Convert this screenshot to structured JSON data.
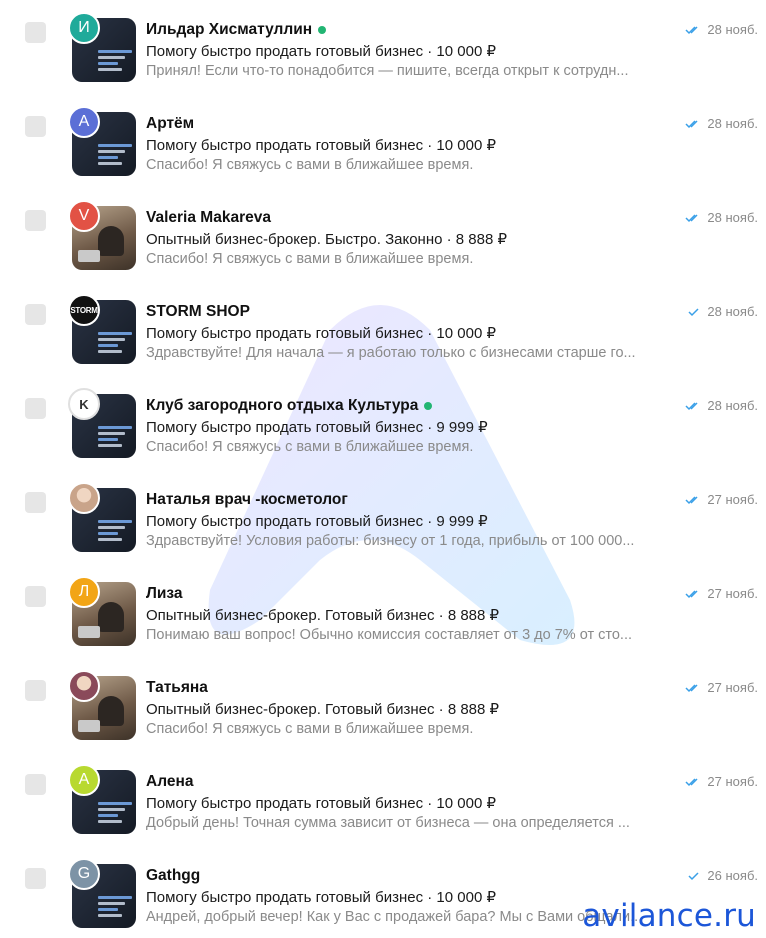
{
  "chats": [
    {
      "name": "Ильдар Хисматуллин",
      "avatar_letter": "И",
      "avatar_color": "#1faa9a",
      "avatar_type": "letter",
      "thumb": "dark",
      "online": true,
      "subject": "Помогу быстро продать готовый бизнес · 10 000 ₽",
      "preview": "Принял! Если что-то понадобится — пишите, всегда открыт к сотрудн...",
      "date": "28 нояб.",
      "ticks": "double"
    },
    {
      "name": "Артём",
      "avatar_letter": "А",
      "avatar_color": "#5b6fd6",
      "avatar_type": "letter",
      "thumb": "dark",
      "online": false,
      "subject": "Помогу быстро продать готовый бизнес · 10 000 ₽",
      "preview": "Спасибо! Я свяжусь с вами в ближайшее время.",
      "date": "28 нояб.",
      "ticks": "double"
    },
    {
      "name": "Valeria Makareva",
      "avatar_letter": "V",
      "avatar_color": "#e25245",
      "avatar_type": "letter",
      "thumb": "photo",
      "online": false,
      "subject": "Опытный бизнес-брокер. Быстро. Законно · 8 888 ₽",
      "preview": "Спасибо! Я свяжусь с вами в ближайшее время.",
      "date": "28 нояб.",
      "ticks": "double"
    },
    {
      "name": "STORM SHOP",
      "avatar_letter": "STORM",
      "avatar_color": "#111111",
      "avatar_type": "logo",
      "thumb": "dark",
      "online": false,
      "subject": "Помогу быстро продать готовый бизнес · 10 000 ₽",
      "preview": "Здравствуйте! Для начала — я работаю только с бизнесами старше го...",
      "date": "28 нояб.",
      "ticks": "single"
    },
    {
      "name": "Клуб загородного отдыха Культура",
      "avatar_letter": "K",
      "avatar_color": "#ffffff",
      "avatar_type": "club",
      "thumb": "dark",
      "online": true,
      "subject": "Помогу быстро продать готовый бизнес · 9 999 ₽",
      "preview": "Спасибо! Я свяжусь с вами в ближайшее время.",
      "date": "28 нояб.",
      "ticks": "double"
    },
    {
      "name": "Наталья врач -косметолог",
      "avatar_letter": "",
      "avatar_color": "#c9a48a",
      "avatar_type": "photo",
      "thumb": "dark",
      "online": false,
      "subject": "Помогу быстро продать готовый бизнес · 9 999 ₽",
      "preview": "Здравствуйте! Условия работы: бизнесу от 1 года, прибыль от 100 000...",
      "date": "27 нояб.",
      "ticks": "double"
    },
    {
      "name": "Лиза",
      "avatar_letter": "Л",
      "avatar_color": "#f2a516",
      "avatar_type": "letter",
      "thumb": "photo",
      "online": false,
      "subject": "Опытный бизнес-брокер. Готовый бизнес · 8 888 ₽",
      "preview": "Понимаю ваш вопрос! Обычно комиссия составляет от 3 до 7% от сто...",
      "date": "27 нояб.",
      "ticks": "double"
    },
    {
      "name": "Татьяна",
      "avatar_letter": "",
      "avatar_color": "#8a4a5a",
      "avatar_type": "photo",
      "thumb": "photo",
      "online": false,
      "subject": "Опытный бизнес-брокер. Готовый бизнес · 8 888 ₽",
      "preview": "Спасибо! Я свяжусь с вами в ближайшее время.",
      "date": "27 нояб.",
      "ticks": "double"
    },
    {
      "name": "Алена",
      "avatar_letter": "А",
      "avatar_color": "#b8d930",
      "avatar_type": "letter",
      "thumb": "dark",
      "online": false,
      "subject": "Помогу быстро продать готовый бизнес · 10 000 ₽",
      "preview": "Добрый день! Точная сумма зависит от бизнеса — она определяется ...",
      "date": "27 нояб.",
      "ticks": "double"
    },
    {
      "name": "Gathgg",
      "avatar_letter": "G",
      "avatar_color": "#7d93a6",
      "avatar_type": "letter",
      "thumb": "dark",
      "online": false,
      "subject": "Помогу быстро продать готовый бизнес · 10 000 ₽",
      "preview": "Андрей, добрый вечер! Как у Вас с продажей бара? Мы с Вами общали...",
      "date": "26 нояб.",
      "ticks": "single"
    }
  ],
  "watermark_text": "avilance.ru"
}
